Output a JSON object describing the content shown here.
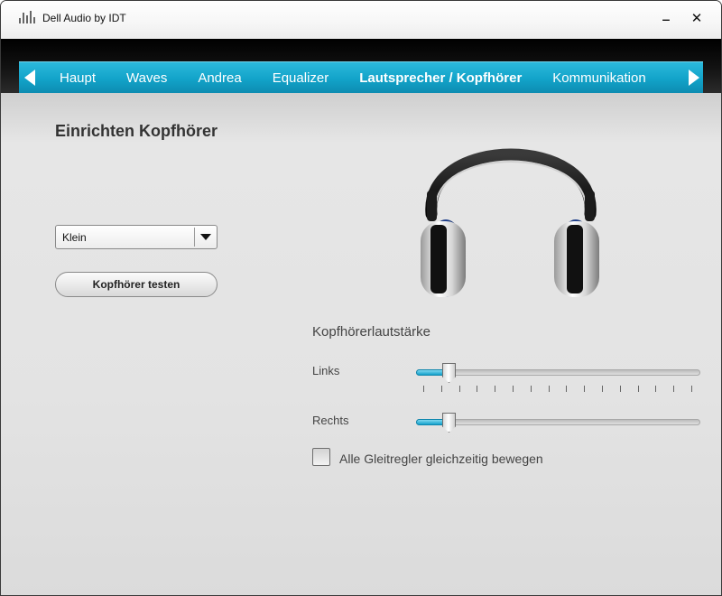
{
  "window": {
    "title": "Dell Audio by IDT",
    "minimize_label": "‒",
    "close_label": "✕"
  },
  "tabs": [
    {
      "label": "Haupt",
      "active": false
    },
    {
      "label": "Waves",
      "active": false
    },
    {
      "label": "Andrea",
      "active": false
    },
    {
      "label": "Equalizer",
      "active": false
    },
    {
      "label": "Lautsprecher / Kopfhörer",
      "active": true
    },
    {
      "label": "Kommunikation",
      "active": false
    }
  ],
  "setup": {
    "title": "Einrichten Kopfhörer",
    "size_select": {
      "value": "Klein"
    },
    "test_button_label": "Kopfhörer testen"
  },
  "volume": {
    "title": "Kopfhörerlautstärke",
    "left": {
      "label": "Links",
      "value_fraction": 0.115
    },
    "right": {
      "label": "Rechts",
      "value_fraction": 0.115
    },
    "tick_count": 16,
    "link_checkbox": {
      "label": "Alle Gleitregler gleichzeitig bewegen",
      "checked": false
    }
  },
  "colors": {
    "accent": "#12a3c9",
    "title_bar_dark": "#000000"
  }
}
